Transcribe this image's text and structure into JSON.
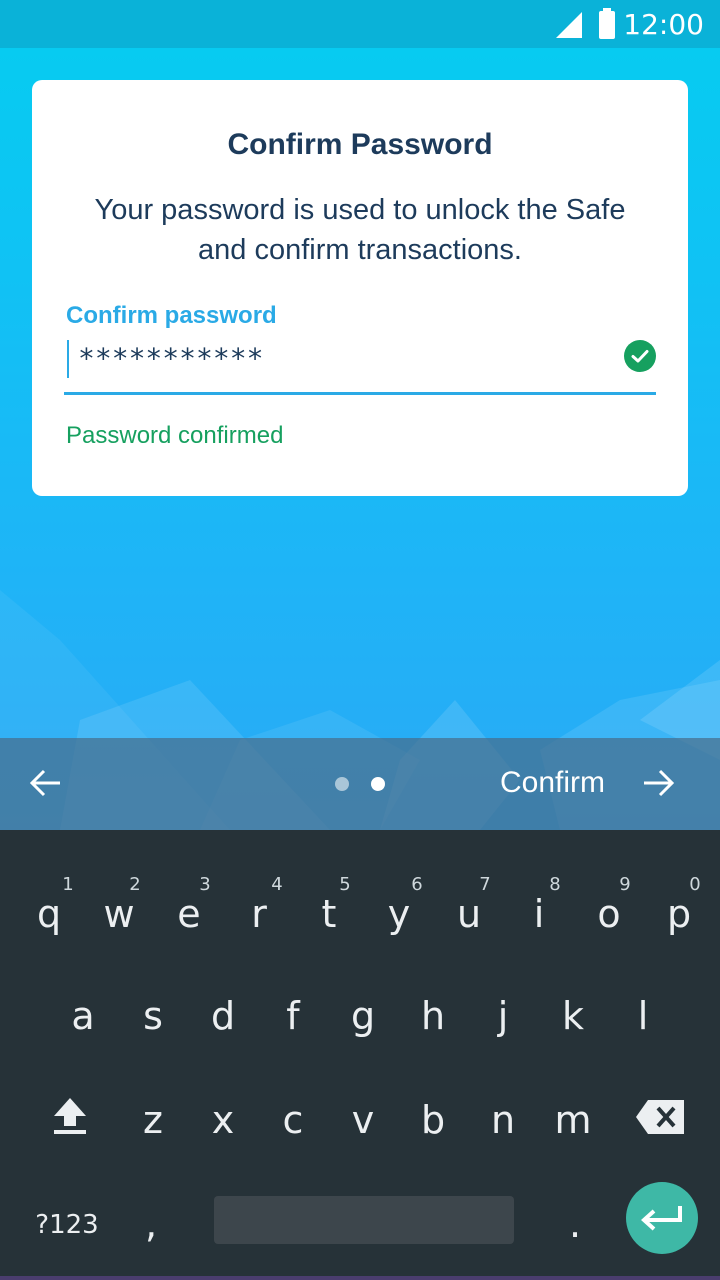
{
  "status_bar": {
    "time": "12:00",
    "signal_icon": "signal-icon",
    "battery_icon": "battery-icon"
  },
  "card": {
    "title": "Confirm Password",
    "description": "Your password is used to unlock the Safe and confirm transactions.",
    "field_label": "Confirm password",
    "field_value": "***********",
    "status_icon": "check-circle-icon",
    "status_text": "Password confirmed"
  },
  "navigation": {
    "back_icon": "arrow-left-icon",
    "page_count": 2,
    "active_page": 2,
    "confirm_label": "Confirm",
    "forward_icon": "arrow-right-icon"
  },
  "keyboard": {
    "row1": [
      "q",
      "w",
      "e",
      "r",
      "t",
      "y",
      "u",
      "i",
      "o",
      "p"
    ],
    "row1_hints": [
      "1",
      "2",
      "3",
      "4",
      "5",
      "6",
      "7",
      "8",
      "9",
      "0"
    ],
    "row2": [
      "a",
      "s",
      "d",
      "f",
      "g",
      "h",
      "j",
      "k",
      "l"
    ],
    "row3": [
      "z",
      "x",
      "c",
      "v",
      "b",
      "n",
      "m"
    ],
    "symbols_key": "?123",
    "comma_key": ",",
    "period_key": ".",
    "shift_icon": "shift-icon",
    "backspace_icon": "backspace-icon",
    "enter_icon": "enter-icon"
  },
  "colors": {
    "accent": "#2aaae6",
    "success": "#16a05f",
    "title_text": "#1d3b5b",
    "keyboard_bg": "#263238",
    "enter_key": "#3eb8a6"
  }
}
